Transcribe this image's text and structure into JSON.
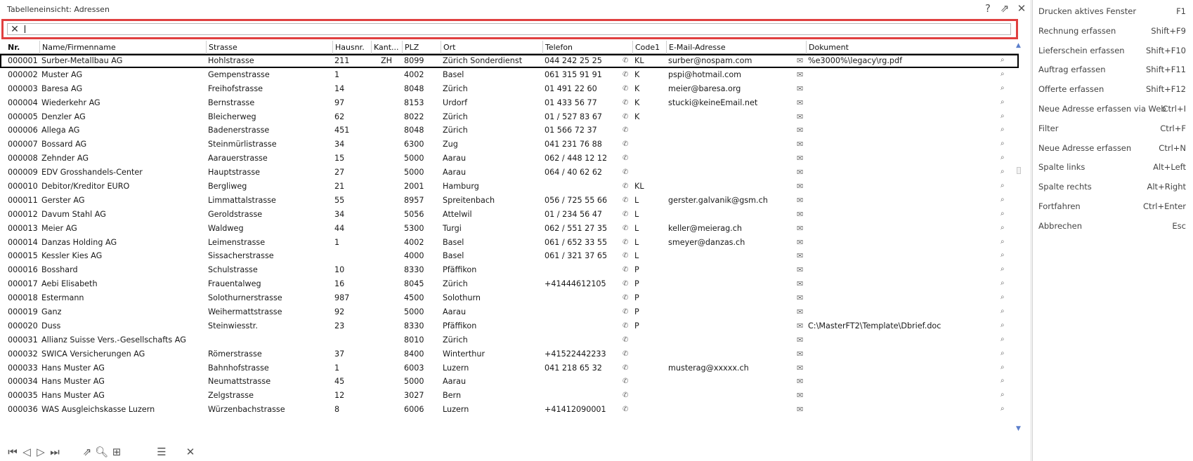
{
  "window": {
    "title": "Tabelleneinsicht: Adressen"
  },
  "titlebar_icons": [
    "help-icon",
    "share-icon",
    "close-icon"
  ],
  "search": {
    "value": "",
    "placeholder": ""
  },
  "columns": [
    "Nr.",
    "Name/Firmenname",
    "Strasse",
    "Hausnr.",
    "Kant...",
    "PLZ",
    "Ort",
    "Telefon",
    "Code1",
    "E-Mail-Adresse",
    "Dokument"
  ],
  "rows": [
    {
      "nr": "000001",
      "name": "Surber-Metallbau AG",
      "strasse": "Hohlstrasse",
      "hausnr": "211",
      "kanton": "ZH",
      "plz": "8099",
      "ort": "Zürich Sonderdienst",
      "telefon": "044 242 25 25",
      "code1": "KL",
      "email": "surber@nospam.com",
      "dokument": "%e3000%\\legacy\\rg.pdf"
    },
    {
      "nr": "000002",
      "name": "Muster AG",
      "strasse": "Gempenstrasse",
      "hausnr": "1",
      "kanton": "",
      "plz": "4002",
      "ort": "Basel",
      "telefon": "061 315 91 91",
      "code1": "K",
      "email": "pspi@hotmail.com",
      "dokument": ""
    },
    {
      "nr": "000003",
      "name": "Baresa  AG",
      "strasse": "Freihofstrasse",
      "hausnr": "14",
      "kanton": "",
      "plz": "8048",
      "ort": "Zürich",
      "telefon": "01 491 22 60",
      "code1": "K",
      "email": "meier@baresa.org",
      "dokument": ""
    },
    {
      "nr": "000004",
      "name": "Wiederkehr AG",
      "strasse": "Bernstrasse",
      "hausnr": "97",
      "kanton": "",
      "plz": "8153",
      "ort": "Urdorf",
      "telefon": "01 433 56 77",
      "code1": "K",
      "email": "stucki@keineEmail.net",
      "dokument": ""
    },
    {
      "nr": "000005",
      "name": "Denzler AG",
      "strasse": "Bleicherweg",
      "hausnr": "62",
      "kanton": "",
      "plz": "8022",
      "ort": "Zürich",
      "telefon": "01 / 527 83 67",
      "code1": "K",
      "email": "",
      "dokument": ""
    },
    {
      "nr": "000006",
      "name": "Allega AG",
      "strasse": "Badenerstrasse",
      "hausnr": "451",
      "kanton": "",
      "plz": "8048",
      "ort": "Zürich",
      "telefon": "01 566 72 37",
      "code1": "",
      "email": "",
      "dokument": ""
    },
    {
      "nr": "000007",
      "name": "Bossard AG",
      "strasse": "Steinmürlistrasse",
      "hausnr": "34",
      "kanton": "",
      "plz": "6300",
      "ort": "Zug",
      "telefon": "041 231 76 88",
      "code1": "",
      "email": "",
      "dokument": ""
    },
    {
      "nr": "000008",
      "name": "Zehnder AG",
      "strasse": "Aarauerstrasse",
      "hausnr": "15",
      "kanton": "",
      "plz": "5000",
      "ort": "Aarau",
      "telefon": "062 / 448 12 12",
      "code1": "",
      "email": "",
      "dokument": ""
    },
    {
      "nr": "000009",
      "name": "EDV Grosshandels-Center",
      "strasse": "Hauptstrasse",
      "hausnr": "27",
      "kanton": "",
      "plz": "5000",
      "ort": "Aarau",
      "telefon": "064 / 40 62 62",
      "code1": "",
      "email": "",
      "dokument": ""
    },
    {
      "nr": "000010",
      "name": "Debitor/Kreditor EURO",
      "strasse": "Bergliweg",
      "hausnr": "21",
      "kanton": "",
      "plz": "2001",
      "ort": "Hamburg",
      "telefon": "",
      "code1": "KL",
      "email": "",
      "dokument": ""
    },
    {
      "nr": "000011",
      "name": "Gerster AG",
      "strasse": "Limmattalstrasse",
      "hausnr": "55",
      "kanton": "",
      "plz": "8957",
      "ort": "Spreitenbach",
      "telefon": "056 / 725 55 66",
      "code1": "L",
      "email": "gerster.galvanik@gsm.ch",
      "dokument": ""
    },
    {
      "nr": "000012",
      "name": "Davum Stahl AG",
      "strasse": "Geroldstrasse",
      "hausnr": "34",
      "kanton": "",
      "plz": "5056",
      "ort": "Attelwil",
      "telefon": "01 / 234 56 47",
      "code1": "L",
      "email": "",
      "dokument": ""
    },
    {
      "nr": "000013",
      "name": "Meier AG",
      "strasse": "Waldweg",
      "hausnr": "44",
      "kanton": "",
      "plz": "5300",
      "ort": "Turgi",
      "telefon": "062 / 551 27 35",
      "code1": "L",
      "email": "keller@meierag.ch",
      "dokument": ""
    },
    {
      "nr": "000014",
      "name": "Danzas Holding AG",
      "strasse": "Leimenstrasse",
      "hausnr": "1",
      "kanton": "",
      "plz": "4002",
      "ort": "Basel",
      "telefon": "061 / 652 33 55",
      "code1": "L",
      "email": "smeyer@danzas.ch",
      "dokument": ""
    },
    {
      "nr": "000015",
      "name": "Kessler Kies AG",
      "strasse": "Sissacherstrasse",
      "hausnr": "",
      "kanton": "",
      "plz": "4000",
      "ort": "Basel",
      "telefon": "061 / 321 37 65",
      "code1": "L",
      "email": "",
      "dokument": ""
    },
    {
      "nr": "000016",
      "name": "Bosshard",
      "strasse": "Schulstrasse",
      "hausnr": "10",
      "kanton": "",
      "plz": "8330",
      "ort": "Pfäffikon",
      "telefon": "",
      "code1": "P",
      "email": "",
      "dokument": ""
    },
    {
      "nr": "000017",
      "name": "Aebi Elisabeth",
      "strasse": "Frauentalweg",
      "hausnr": "16",
      "kanton": "",
      "plz": "8045",
      "ort": "Zürich",
      "telefon": "+41444612105",
      "code1": "P",
      "email": "",
      "dokument": ""
    },
    {
      "nr": "000018",
      "name": "Estermann",
      "strasse": "Solothurnerstrasse",
      "hausnr": "987",
      "kanton": "",
      "plz": "4500",
      "ort": "Solothurn",
      "telefon": "",
      "code1": "P",
      "email": "",
      "dokument": ""
    },
    {
      "nr": "000019",
      "name": "Ganz",
      "strasse": "Weihermattstrasse",
      "hausnr": "92",
      "kanton": "",
      "plz": "5000",
      "ort": "Aarau",
      "telefon": "",
      "code1": "P",
      "email": "",
      "dokument": ""
    },
    {
      "nr": "000020",
      "name": "Duss",
      "strasse": "Steinwiesstr.",
      "hausnr": "23",
      "kanton": "",
      "plz": "8330",
      "ort": "Pfäffikon",
      "telefon": "",
      "code1": "P",
      "email": "",
      "dokument": "C:\\MasterFT2\\Template\\Dbrief.doc"
    },
    {
      "nr": "000031",
      "name": "Allianz Suisse Vers.-Gesellschafts AG",
      "strasse": "",
      "hausnr": "",
      "kanton": "",
      "plz": "8010",
      "ort": "Zürich",
      "telefon": "",
      "code1": "",
      "email": "",
      "dokument": ""
    },
    {
      "nr": "000032",
      "name": "SWICA Versicherungen AG",
      "strasse": "Römerstrasse",
      "hausnr": "37",
      "kanton": "",
      "plz": "8400",
      "ort": "Winterthur",
      "telefon": "+41522442233",
      "code1": "",
      "email": "",
      "dokument": ""
    },
    {
      "nr": "000033",
      "name": "Hans Muster AG",
      "strasse": "Bahnhofstrasse",
      "hausnr": "1",
      "kanton": "",
      "plz": "6003",
      "ort": "Luzern",
      "telefon": "041 218 65 32",
      "code1": "",
      "email": "musterag@xxxxx.ch",
      "dokument": ""
    },
    {
      "nr": "000034",
      "name": "Hans Muster AG",
      "strasse": "Neumattstrasse",
      "hausnr": "45",
      "kanton": "",
      "plz": "5000",
      "ort": "Aarau",
      "telefon": "",
      "code1": "",
      "email": "",
      "dokument": ""
    },
    {
      "nr": "000035",
      "name": "Hans Muster AG",
      "strasse": "Zelgstrasse",
      "hausnr": "12",
      "kanton": "",
      "plz": "3027",
      "ort": "Bern",
      "telefon": "",
      "code1": "",
      "email": "",
      "dokument": ""
    },
    {
      "nr": "000036",
      "name": "WAS Ausgleichskasse Luzern",
      "strasse": "Würzenbachstrasse",
      "hausnr": "8",
      "kanton": "",
      "plz": "6006",
      "ort": "Luzern",
      "telefon": "+41412090001",
      "code1": "",
      "email": "",
      "dokument": ""
    }
  ],
  "footer_icons": [
    "first-record-icon",
    "previous-record-icon",
    "next-record-icon",
    "last-record-icon",
    "share-icon",
    "search-icon",
    "new-record-icon",
    "list-icon",
    "close-icon"
  ],
  "side_menu": [
    {
      "label": "Drucken aktives Fenster",
      "shortcut": "F1"
    },
    {
      "label": "Rechnung erfassen",
      "shortcut": "Shift+F9"
    },
    {
      "label": "Lieferschein erfassen",
      "shortcut": "Shift+F10"
    },
    {
      "label": "Auftrag erfassen",
      "shortcut": "Shift+F11"
    },
    {
      "label": "Offerte erfassen",
      "shortcut": "Shift+F12"
    },
    {
      "label": "Neue Adresse erfassen via Web",
      "shortcut": "Ctrl+I"
    },
    {
      "label": "Filter",
      "shortcut": "Ctrl+F"
    },
    {
      "label": "Neue Adresse erfassen",
      "shortcut": "Ctrl+N"
    },
    {
      "label": "Spalte links",
      "shortcut": "Alt+Left"
    },
    {
      "label": "Spalte rechts",
      "shortcut": "Alt+Right"
    },
    {
      "label": "Fortfahren",
      "shortcut": "Ctrl+Enter"
    },
    {
      "label": "Abbrechen",
      "shortcut": "Esc"
    }
  ],
  "colors": {
    "search_border": "#e04040",
    "scroll_arrow": "#5b7ecb",
    "selected_outline": "#000000"
  }
}
